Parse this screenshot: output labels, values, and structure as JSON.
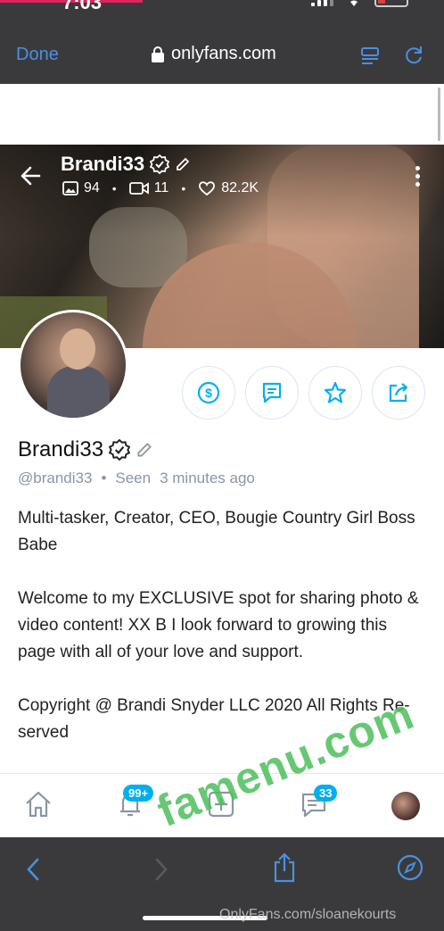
{
  "status_bar": {
    "time": "7:03"
  },
  "browser": {
    "done_label": "Done",
    "url": "onlyfans.com"
  },
  "profile": {
    "name": "Brandi33",
    "handle": "@brandi33",
    "separator": "•",
    "seen_label": "Seen",
    "seen_time": "3 minutes ago",
    "stats": {
      "photos": "94",
      "videos": "11",
      "likes": "82.2K",
      "dot": "•"
    },
    "bio": [
      "Multi-tasker, Creator, CEO, Bougie Country Girl Boss Babe",
      "Welcome to my EXCLUSIVE spot for sharing photo & video content! XX B I look forward to growing this page with all of your love and support.",
      "Copyright @ Brandi Snyder LLC 2020 All Rights Re-served"
    ]
  },
  "actions": [
    {
      "icon": "dollar-tip-icon"
    },
    {
      "icon": "message-icon"
    },
    {
      "icon": "star-icon"
    },
    {
      "icon": "share-icon"
    }
  ],
  "app_nav": {
    "notifications_badge": "99+",
    "messages_badge": "33"
  },
  "watermarks": {
    "big": "famenu.com",
    "small": "OnlyFans.com/sloanekourts"
  },
  "colors": {
    "accent": "#00aff0",
    "browser_chrome": "#3a3a3c",
    "safari_blue": "#4a90e2",
    "watermark_green": "#4cbe5a"
  }
}
